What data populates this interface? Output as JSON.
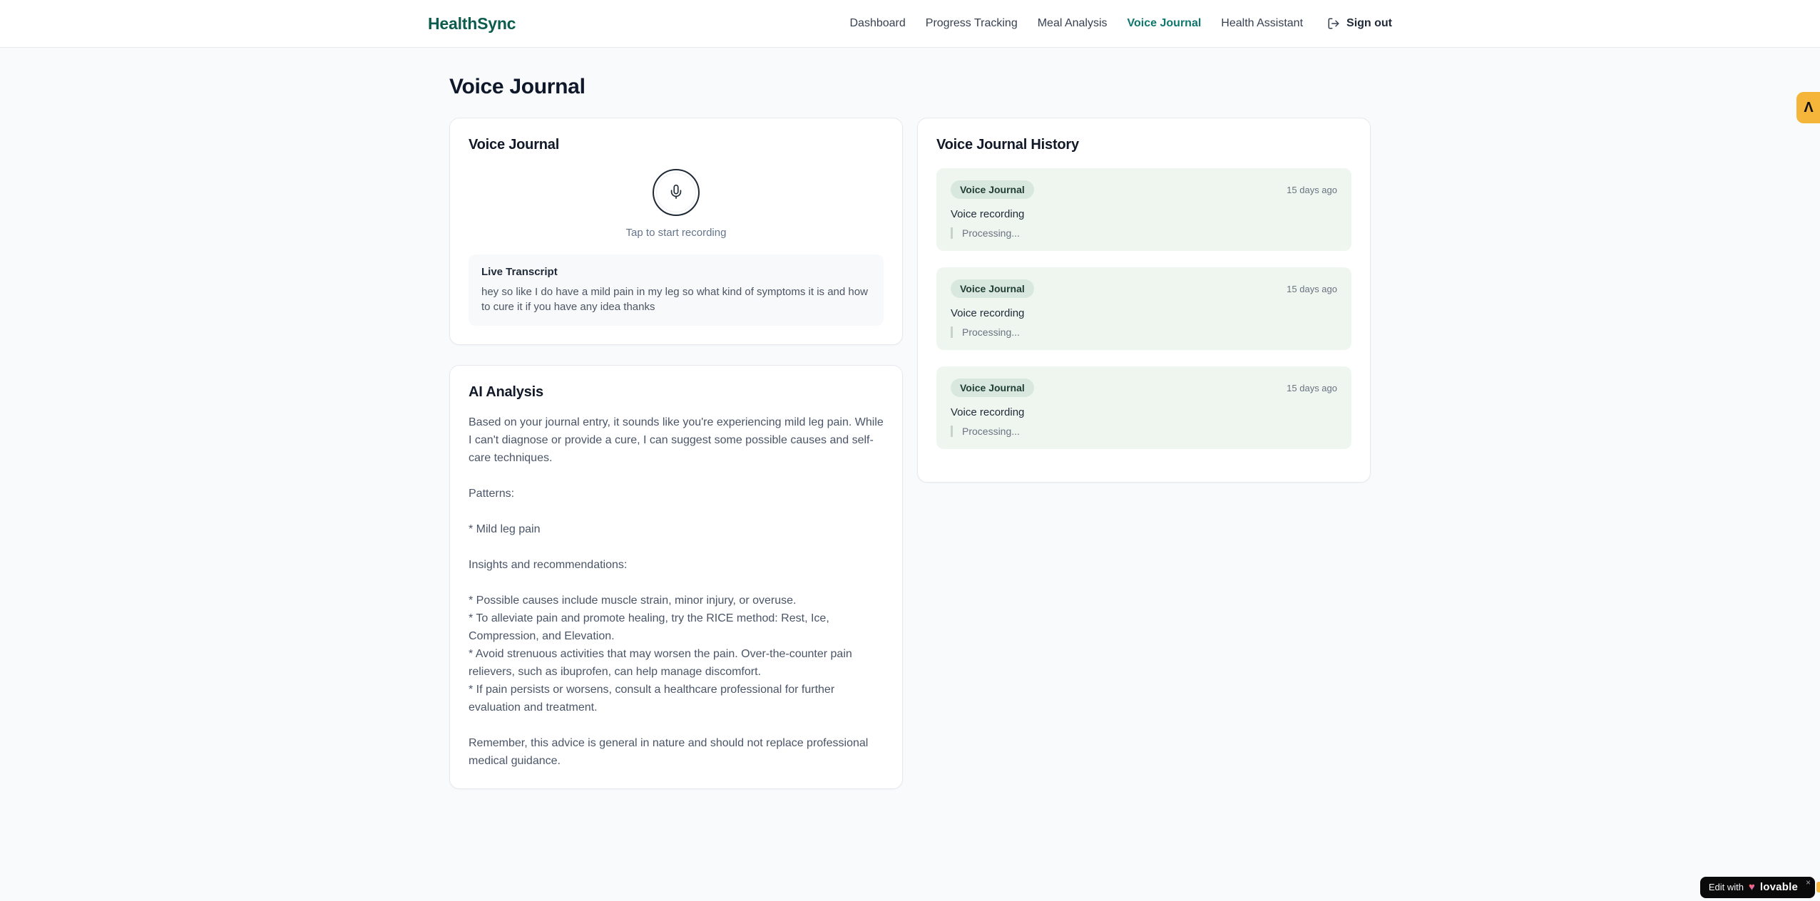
{
  "nav": {
    "logo": "HealthSync",
    "items": [
      {
        "label": "Dashboard",
        "active": false
      },
      {
        "label": "Progress Tracking",
        "active": false
      },
      {
        "label": "Meal Analysis",
        "active": false
      },
      {
        "label": "Voice Journal",
        "active": true
      },
      {
        "label": "Health Assistant",
        "active": false
      }
    ],
    "sign_out_label": "Sign out"
  },
  "page": {
    "title": "Voice Journal"
  },
  "recorder": {
    "title": "Voice Journal",
    "tap_hint": "Tap to start recording",
    "transcript_label": "Live Transcript",
    "transcript_text": "hey so like I do have a mild pain in my leg so what kind of symptoms it is and how to cure it if you have any idea thanks"
  },
  "analysis": {
    "title": "AI Analysis",
    "paragraphs": [
      "Based on your journal entry, it sounds like you're experiencing mild leg pain. While I can't diagnose or provide a cure, I can suggest some possible causes and self-care techniques.",
      "Patterns:",
      "* Mild leg pain",
      "Insights and recommendations:",
      "* Possible causes include muscle strain, minor injury, or overuse.\n* To alleviate pain and promote healing, try the RICE method: Rest, Ice, Compression, and Elevation.\n* Avoid strenuous activities that may worsen the pain. Over-the-counter pain relievers, such as ibuprofen, can help manage discomfort.\n* If pain persists or worsens, consult a healthcare professional for further evaluation and treatment.",
      "Remember, this advice is general in nature and should not replace professional medical guidance."
    ]
  },
  "history": {
    "title": "Voice Journal History",
    "entries": [
      {
        "badge": "Voice Journal",
        "time": "15 days ago",
        "title": "Voice recording",
        "status": "Processing..."
      },
      {
        "badge": "Voice Journal",
        "time": "15 days ago",
        "title": "Voice recording",
        "status": "Processing..."
      },
      {
        "badge": "Voice Journal",
        "time": "15 days ago",
        "title": "Voice recording",
        "status": "Processing..."
      }
    ]
  },
  "floating": {
    "corner_glyph": "Λ",
    "edit_prefix": "Edit with",
    "edit_heart": "♥",
    "edit_brand": "lovable",
    "close_glyph": "×"
  },
  "colors": {
    "brand_green": "#0b5c4d",
    "active_nav_teal": "#0f766e",
    "entry_bg_green": "#eff6f0",
    "badge_bg_green": "#d9e8de",
    "corner_orange": "#f5b43a",
    "page_bg": "#f8fafc"
  }
}
